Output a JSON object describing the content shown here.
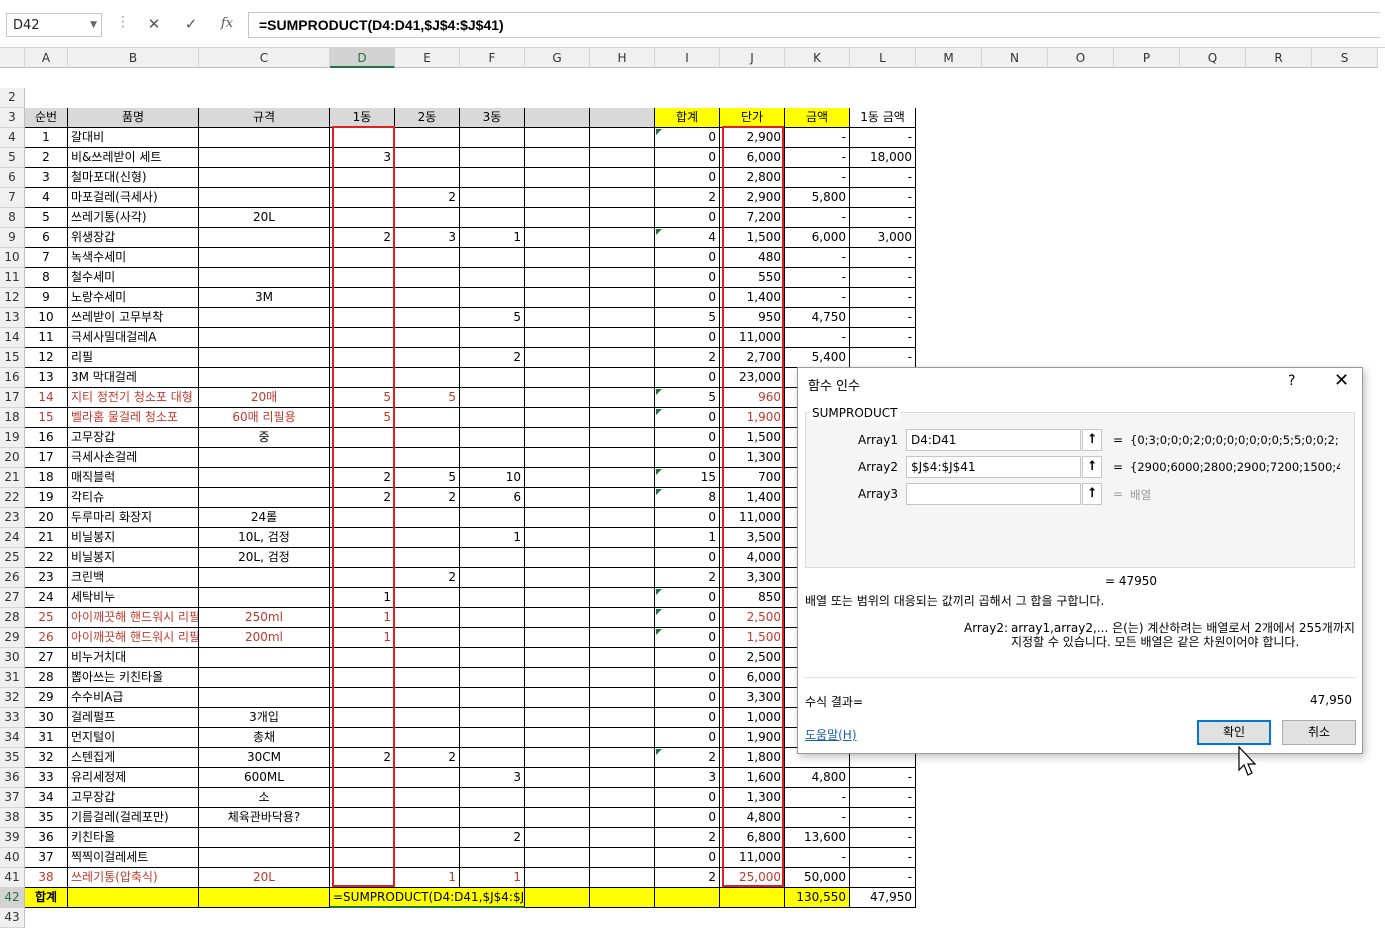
{
  "formula_bar": {
    "name_box": "D42",
    "cancel_icon": "✕",
    "enter_icon": "✓",
    "fx_icon": "fx",
    "formula": "=SUMPRODUCT(D4:D41,$J$4:$J$41)"
  },
  "columns": [
    "A",
    "B",
    "C",
    "D",
    "E",
    "F",
    "G",
    "H",
    "I",
    "J",
    "K",
    "L",
    "M",
    "N",
    "O",
    "P",
    "Q",
    "R",
    "S"
  ],
  "header_row": {
    "num": "순번",
    "name": "품명",
    "spec": "규격",
    "d1": "1동",
    "d2": "2동",
    "d3": "3동",
    "total": "합계",
    "price": "단가",
    "amount": "금액",
    "amount1": "1동 금액"
  },
  "rows": [
    {
      "n": "1",
      "name": "갈대비",
      "spec": "",
      "d1": "",
      "d2": "",
      "d3": "",
      "total": "0",
      "price": "2,900",
      "amount": "-",
      "amount1": "-",
      "red": false,
      "tri": true
    },
    {
      "n": "2",
      "name": "비&쓰레받이 세트",
      "spec": "",
      "d1": "3",
      "d2": "",
      "d3": "",
      "total": "0",
      "price": "6,000",
      "amount": "-",
      "amount1": "18,000",
      "red": false,
      "tri": false
    },
    {
      "n": "3",
      "name": "철마포대(신형)",
      "spec": "",
      "d1": "",
      "d2": "",
      "d3": "",
      "total": "0",
      "price": "2,800",
      "amount": "-",
      "amount1": "-",
      "red": false,
      "tri": false
    },
    {
      "n": "4",
      "name": "마포걸레(극세사)",
      "spec": "",
      "d1": "",
      "d2": "2",
      "d3": "",
      "total": "2",
      "price": "2,900",
      "amount": "5,800",
      "amount1": "-",
      "red": false,
      "tri": false
    },
    {
      "n": "5",
      "name": "쓰레기통(사각)",
      "spec": "20L",
      "d1": "",
      "d2": "",
      "d3": "",
      "total": "0",
      "price": "7,200",
      "amount": "-",
      "amount1": "-",
      "red": false,
      "tri": false
    },
    {
      "n": "6",
      "name": "위생장갑",
      "spec": "",
      "d1": "2",
      "d2": "3",
      "d3": "1",
      "total": "4",
      "price": "1,500",
      "amount": "6,000",
      "amount1": "3,000",
      "red": false,
      "tri": true
    },
    {
      "n": "7",
      "name": "녹색수세미",
      "spec": "",
      "d1": "",
      "d2": "",
      "d3": "",
      "total": "0",
      "price": "480",
      "amount": "-",
      "amount1": "-",
      "red": false,
      "tri": false
    },
    {
      "n": "8",
      "name": "철수세미",
      "spec": "",
      "d1": "",
      "d2": "",
      "d3": "",
      "total": "0",
      "price": "550",
      "amount": "-",
      "amount1": "-",
      "red": false,
      "tri": false
    },
    {
      "n": "9",
      "name": "노랑수세미",
      "spec": "3M",
      "d1": "",
      "d2": "",
      "d3": "",
      "total": "0",
      "price": "1,400",
      "amount": "-",
      "amount1": "-",
      "red": false,
      "tri": false
    },
    {
      "n": "10",
      "name": "쓰레받이 고무부착",
      "spec": "",
      "d1": "",
      "d2": "",
      "d3": "5",
      "total": "5",
      "price": "950",
      "amount": "4,750",
      "amount1": "-",
      "red": false,
      "tri": false
    },
    {
      "n": "11",
      "name": "극세사밀대걸레A",
      "spec": "",
      "d1": "",
      "d2": "",
      "d3": "",
      "total": "0",
      "price": "11,000",
      "amount": "-",
      "amount1": "-",
      "red": false,
      "tri": false
    },
    {
      "n": "12",
      "name": "리필",
      "spec": "",
      "d1": "",
      "d2": "",
      "d3": "2",
      "total": "2",
      "price": "2,700",
      "amount": "5,400",
      "amount1": "-",
      "red": false,
      "tri": false
    },
    {
      "n": "13",
      "name": "3M 막대걸레",
      "spec": "",
      "d1": "",
      "d2": "",
      "d3": "",
      "total": "0",
      "price": "23,000",
      "amount": "-",
      "amount1": "-",
      "red": false,
      "tri": false
    },
    {
      "n": "14",
      "name": "지티 정전기 청소포 대형",
      "spec": "20매",
      "d1": "5",
      "d2": "5",
      "d3": "",
      "total": "5",
      "price": "960",
      "amount": "",
      "amount1": "",
      "red": true,
      "tri": true
    },
    {
      "n": "15",
      "name": "벨라홈 물걸레 청소포",
      "spec": "60매 리필용",
      "d1": "5",
      "d2": "",
      "d3": "",
      "total": "0",
      "price": "1,900",
      "amount": "",
      "amount1": "",
      "red": true,
      "tri": true
    },
    {
      "n": "16",
      "name": "고무장갑",
      "spec": "중",
      "d1": "",
      "d2": "",
      "d3": "",
      "total": "0",
      "price": "1,500",
      "amount": "",
      "amount1": "",
      "red": false,
      "tri": false
    },
    {
      "n": "17",
      "name": "극세사손걸레",
      "spec": "",
      "d1": "",
      "d2": "",
      "d3": "",
      "total": "0",
      "price": "1,300",
      "amount": "",
      "amount1": "",
      "red": false,
      "tri": false
    },
    {
      "n": "18",
      "name": "매직블럭",
      "spec": "",
      "d1": "2",
      "d2": "5",
      "d3": "10",
      "total": "15",
      "price": "700",
      "amount": "",
      "amount1": "",
      "red": false,
      "tri": true
    },
    {
      "n": "19",
      "name": "각티슈",
      "spec": "",
      "d1": "2",
      "d2": "2",
      "d3": "6",
      "total": "8",
      "price": "1,400",
      "amount": "",
      "amount1": "",
      "red": false,
      "tri": true
    },
    {
      "n": "20",
      "name": "두루마리 화장지",
      "spec": "24롤",
      "d1": "",
      "d2": "",
      "d3": "",
      "total": "0",
      "price": "11,000",
      "amount": "",
      "amount1": "",
      "red": false,
      "tri": false
    },
    {
      "n": "21",
      "name": "비닐봉지",
      "spec": "10L, 검정",
      "d1": "",
      "d2": "",
      "d3": "1",
      "total": "1",
      "price": "3,500",
      "amount": "",
      "amount1": "",
      "red": false,
      "tri": false
    },
    {
      "n": "22",
      "name": "비닐봉지",
      "spec": "20L, 검정",
      "d1": "",
      "d2": "",
      "d3": "",
      "total": "0",
      "price": "4,000",
      "amount": "",
      "amount1": "",
      "red": false,
      "tri": false
    },
    {
      "n": "23",
      "name": "크린백",
      "spec": "",
      "d1": "",
      "d2": "2",
      "d3": "",
      "total": "2",
      "price": "3,300",
      "amount": "",
      "amount1": "",
      "red": false,
      "tri": false
    },
    {
      "n": "24",
      "name": "세탁비누",
      "spec": "",
      "d1": "1",
      "d2": "",
      "d3": "",
      "total": "0",
      "price": "850",
      "amount": "",
      "amount1": "",
      "red": false,
      "tri": true
    },
    {
      "n": "25",
      "name": "아이깨끗해 핸드워시 리필",
      "spec": "250ml",
      "d1": "1",
      "d2": "",
      "d3": "",
      "total": "0",
      "price": "2,500",
      "amount": "",
      "amount1": "",
      "red": true,
      "tri": true
    },
    {
      "n": "26",
      "name": "아이깨끗해 핸드워시 리필",
      "spec": "200ml",
      "d1": "1",
      "d2": "",
      "d3": "",
      "total": "0",
      "price": "1,500",
      "amount": "",
      "amount1": "",
      "red": true,
      "tri": true
    },
    {
      "n": "27",
      "name": "비누거치대",
      "spec": "",
      "d1": "",
      "d2": "",
      "d3": "",
      "total": "0",
      "price": "2,500",
      "amount": "",
      "amount1": "",
      "red": false,
      "tri": false
    },
    {
      "n": "28",
      "name": "뽑아쓰는 키친타올",
      "spec": "",
      "d1": "",
      "d2": "",
      "d3": "",
      "total": "0",
      "price": "6,000",
      "amount": "",
      "amount1": "",
      "red": false,
      "tri": false
    },
    {
      "n": "29",
      "name": "수수비A급",
      "spec": "",
      "d1": "",
      "d2": "",
      "d3": "",
      "total": "0",
      "price": "3,300",
      "amount": "",
      "amount1": "",
      "red": false,
      "tri": false
    },
    {
      "n": "30",
      "name": "걸레펄프",
      "spec": "3개입",
      "d1": "",
      "d2": "",
      "d3": "",
      "total": "0",
      "price": "1,000",
      "amount": "",
      "amount1": "",
      "red": false,
      "tri": false
    },
    {
      "n": "31",
      "name": "먼지털이",
      "spec": "총채",
      "d1": "",
      "d2": "",
      "d3": "",
      "total": "0",
      "price": "1,900",
      "amount": "",
      "amount1": "",
      "red": false,
      "tri": false
    },
    {
      "n": "32",
      "name": "스텐집게",
      "spec": "30CM",
      "d1": "2",
      "d2": "2",
      "d3": "",
      "total": "2",
      "price": "1,800",
      "amount": "",
      "amount1": "",
      "red": false,
      "tri": true
    },
    {
      "n": "33",
      "name": "유리세정제",
      "spec": "600ML",
      "d1": "",
      "d2": "",
      "d3": "3",
      "total": "3",
      "price": "1,600",
      "amount": "4,800",
      "amount1": "-",
      "red": false,
      "tri": false
    },
    {
      "n": "34",
      "name": "고무장갑",
      "spec": "소",
      "d1": "",
      "d2": "",
      "d3": "",
      "total": "0",
      "price": "1,300",
      "amount": "-",
      "amount1": "-",
      "red": false,
      "tri": false
    },
    {
      "n": "35",
      "name": "기름걸레(걸레포만)",
      "spec": "체육관바닥용?",
      "d1": "",
      "d2": "",
      "d3": "",
      "total": "0",
      "price": "4,800",
      "amount": "-",
      "amount1": "-",
      "red": false,
      "tri": false
    },
    {
      "n": "36",
      "name": "키친타올",
      "spec": "",
      "d1": "",
      "d2": "",
      "d3": "2",
      "total": "2",
      "price": "6,800",
      "amount": "13,600",
      "amount1": "-",
      "red": false,
      "tri": false
    },
    {
      "n": "37",
      "name": "찍찍이걸레세트",
      "spec": "",
      "d1": "",
      "d2": "",
      "d3": "",
      "total": "0",
      "price": "11,000",
      "amount": "-",
      "amount1": "-",
      "red": false,
      "tri": false
    },
    {
      "n": "38",
      "name": "쓰레기통(압축식)",
      "spec": "20L",
      "d1": "",
      "d2": "1",
      "d3": "1",
      "total": "2",
      "price": "25,000",
      "amount": "50,000",
      "amount1": "-",
      "red": true,
      "tri": false
    }
  ],
  "sum_row": {
    "label": "합계",
    "formula": "=SUMPRODUCT(D4:D41,$J$4:$J$41)",
    "amount": "130,550",
    "amount1": "47,950"
  },
  "dialog": {
    "title": "함수 인수",
    "help_icon": "?",
    "close_icon": "✕",
    "function_name": "SUMPRODUCT",
    "args": [
      {
        "label": "Array1",
        "value": "D4:D41",
        "eq": "=",
        "result": "{0;3;0;0;0;2;0;0;0;0;0;0;0;5;5;0;0;2;..."
      },
      {
        "label": "Array2",
        "value": "$J$4:$J$41",
        "eq": "=",
        "result": "{2900;6000;2800;2900;7200;1500;4"
      },
      {
        "label": "Array3",
        "value": "",
        "eq": "=",
        "result": "배열"
      }
    ],
    "mid_result": "=  47950",
    "description": "배열 또는 범위의 대응되는 값끼리 곱해서 그 합을 구합니다.",
    "arg_desc_label": "Array2:",
    "arg_desc": "array1,array2,... 은(는) 계산하려는 배열로서 2개에서 255개까지 지정할 수 있습니다. 모든 배열은 같은 차원이어야 합니다.",
    "result_label": "수식 결과=",
    "result_value": "47,950",
    "help_link": "도움말(H)",
    "ok_label": "확인",
    "cancel_label": "취소"
  },
  "colors": {
    "accent": "#217346",
    "highlight_yellow": "#ffff00",
    "header_gray": "#d9d9d9",
    "red_box": "#e02020",
    "red_text": "#c0392b"
  }
}
